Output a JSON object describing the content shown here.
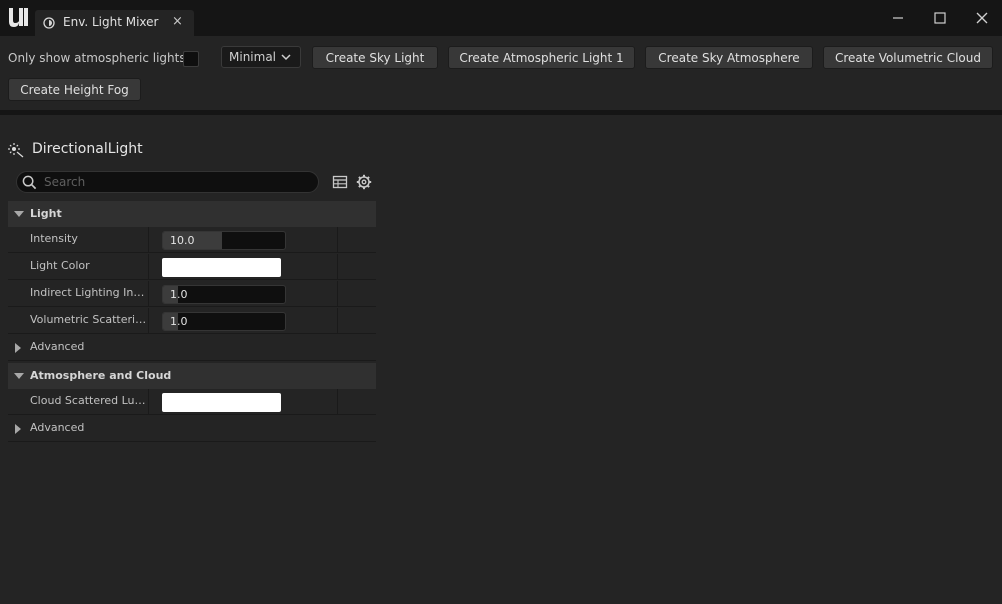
{
  "window": {
    "tab_title": "Env. Light Mixer",
    "tab_close": "×"
  },
  "toolbar": {
    "only_atmospheric_label": "Only show atmospheric lights",
    "only_atmospheric_checked": false,
    "view_mode": "Minimal",
    "buttons": [
      "Create Sky Light",
      "Create Atmospheric Light 1",
      "Create Sky Atmosphere",
      "Create Volumetric Cloud",
      "Create Height Fog"
    ]
  },
  "details": {
    "actor_name": "DirectionalLight",
    "search_placeholder": "Search",
    "categories": [
      {
        "label": "Light",
        "properties": [
          {
            "label": "Intensity",
            "type": "number",
            "value": "10.0"
          },
          {
            "label": "Light Color",
            "type": "color",
            "color": "#ffffff"
          },
          {
            "label": "Indirect Lighting Inten...",
            "type": "number",
            "value": "1.0"
          },
          {
            "label": "Volumetric Scattering...",
            "type": "number",
            "value": "1.0"
          }
        ],
        "advanced_label": "Advanced"
      },
      {
        "label": "Atmosphere and Cloud",
        "properties": [
          {
            "label": "Cloud Scattered Lumi...",
            "type": "color",
            "color": "#ffffff"
          }
        ],
        "advanced_label": "Advanced"
      }
    ]
  },
  "icons": {
    "logo": "unreal-logo-icon",
    "tab": "light-mixer-icon",
    "actor": "directional-light-icon",
    "search": "search-icon",
    "table": "table-view-icon",
    "settings": "gear-icon"
  }
}
